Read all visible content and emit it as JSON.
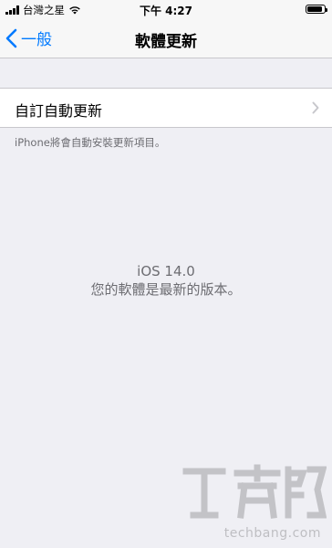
{
  "status_bar": {
    "carrier": "台灣之星",
    "time": "下午 4:27",
    "signal_icon": "cellular-signal-icon",
    "wifi_icon": "wifi-icon",
    "battery_icon": "battery-icon",
    "battery_level": 0.9
  },
  "nav": {
    "back_label": "一般",
    "title": "軟體更新"
  },
  "settings": {
    "auto_update_label": "自訂自動更新",
    "footer_note": "iPhone將會自動安裝更新項目。"
  },
  "version": {
    "name": "iOS 14.0",
    "status": "您的軟體是最新的版本。"
  },
  "watermark": {
    "text": "techbang.com"
  },
  "colors": {
    "accent": "#007aff",
    "background": "#efeff4",
    "secondary_text": "#6d6d72"
  }
}
